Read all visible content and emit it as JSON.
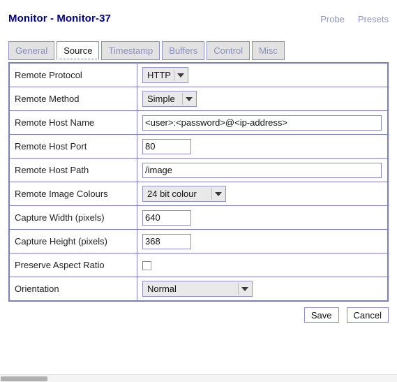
{
  "header": {
    "title": "Monitor - Monitor-37",
    "links": [
      {
        "label": "Probe",
        "name": "probe-link"
      },
      {
        "label": "Presets",
        "name": "presets-link"
      }
    ]
  },
  "tabs": [
    {
      "label": "General",
      "active": false
    },
    {
      "label": "Source",
      "active": true
    },
    {
      "label": "Timestamp",
      "active": false
    },
    {
      "label": "Buffers",
      "active": false
    },
    {
      "label": "Control",
      "active": false
    },
    {
      "label": "Misc",
      "active": false
    }
  ],
  "form": {
    "rows": [
      {
        "label": "Remote Protocol",
        "control": "select",
        "value": "HTTP"
      },
      {
        "label": "Remote Method",
        "control": "select",
        "value": "Simple"
      },
      {
        "label": "Remote Host Name",
        "control": "text",
        "value": "<user>:<password>@<ip-address>"
      },
      {
        "label": "Remote Host Port",
        "control": "text",
        "value": "80"
      },
      {
        "label": "Remote Host Path",
        "control": "text",
        "value": "/image"
      },
      {
        "label": "Remote Image Colours",
        "control": "select",
        "value": "24 bit colour"
      },
      {
        "label": "Capture Width (pixels)",
        "control": "text",
        "value": "640"
      },
      {
        "label": "Capture Height (pixels)",
        "control": "text",
        "value": "368"
      },
      {
        "label": "Preserve Aspect Ratio",
        "control": "checkbox",
        "value": ""
      },
      {
        "label": "Orientation",
        "control": "select",
        "value": "Normal"
      }
    ]
  },
  "buttons": {
    "save": "Save",
    "cancel": "Cancel"
  },
  "colors": {
    "title": "#000080",
    "link": "#8e93c6",
    "border": "#7b80b8",
    "tab_inactive_bg": "#e2e2e2",
    "tab_text": "#8a8fc0",
    "select_bg": "#e9e9e9"
  }
}
